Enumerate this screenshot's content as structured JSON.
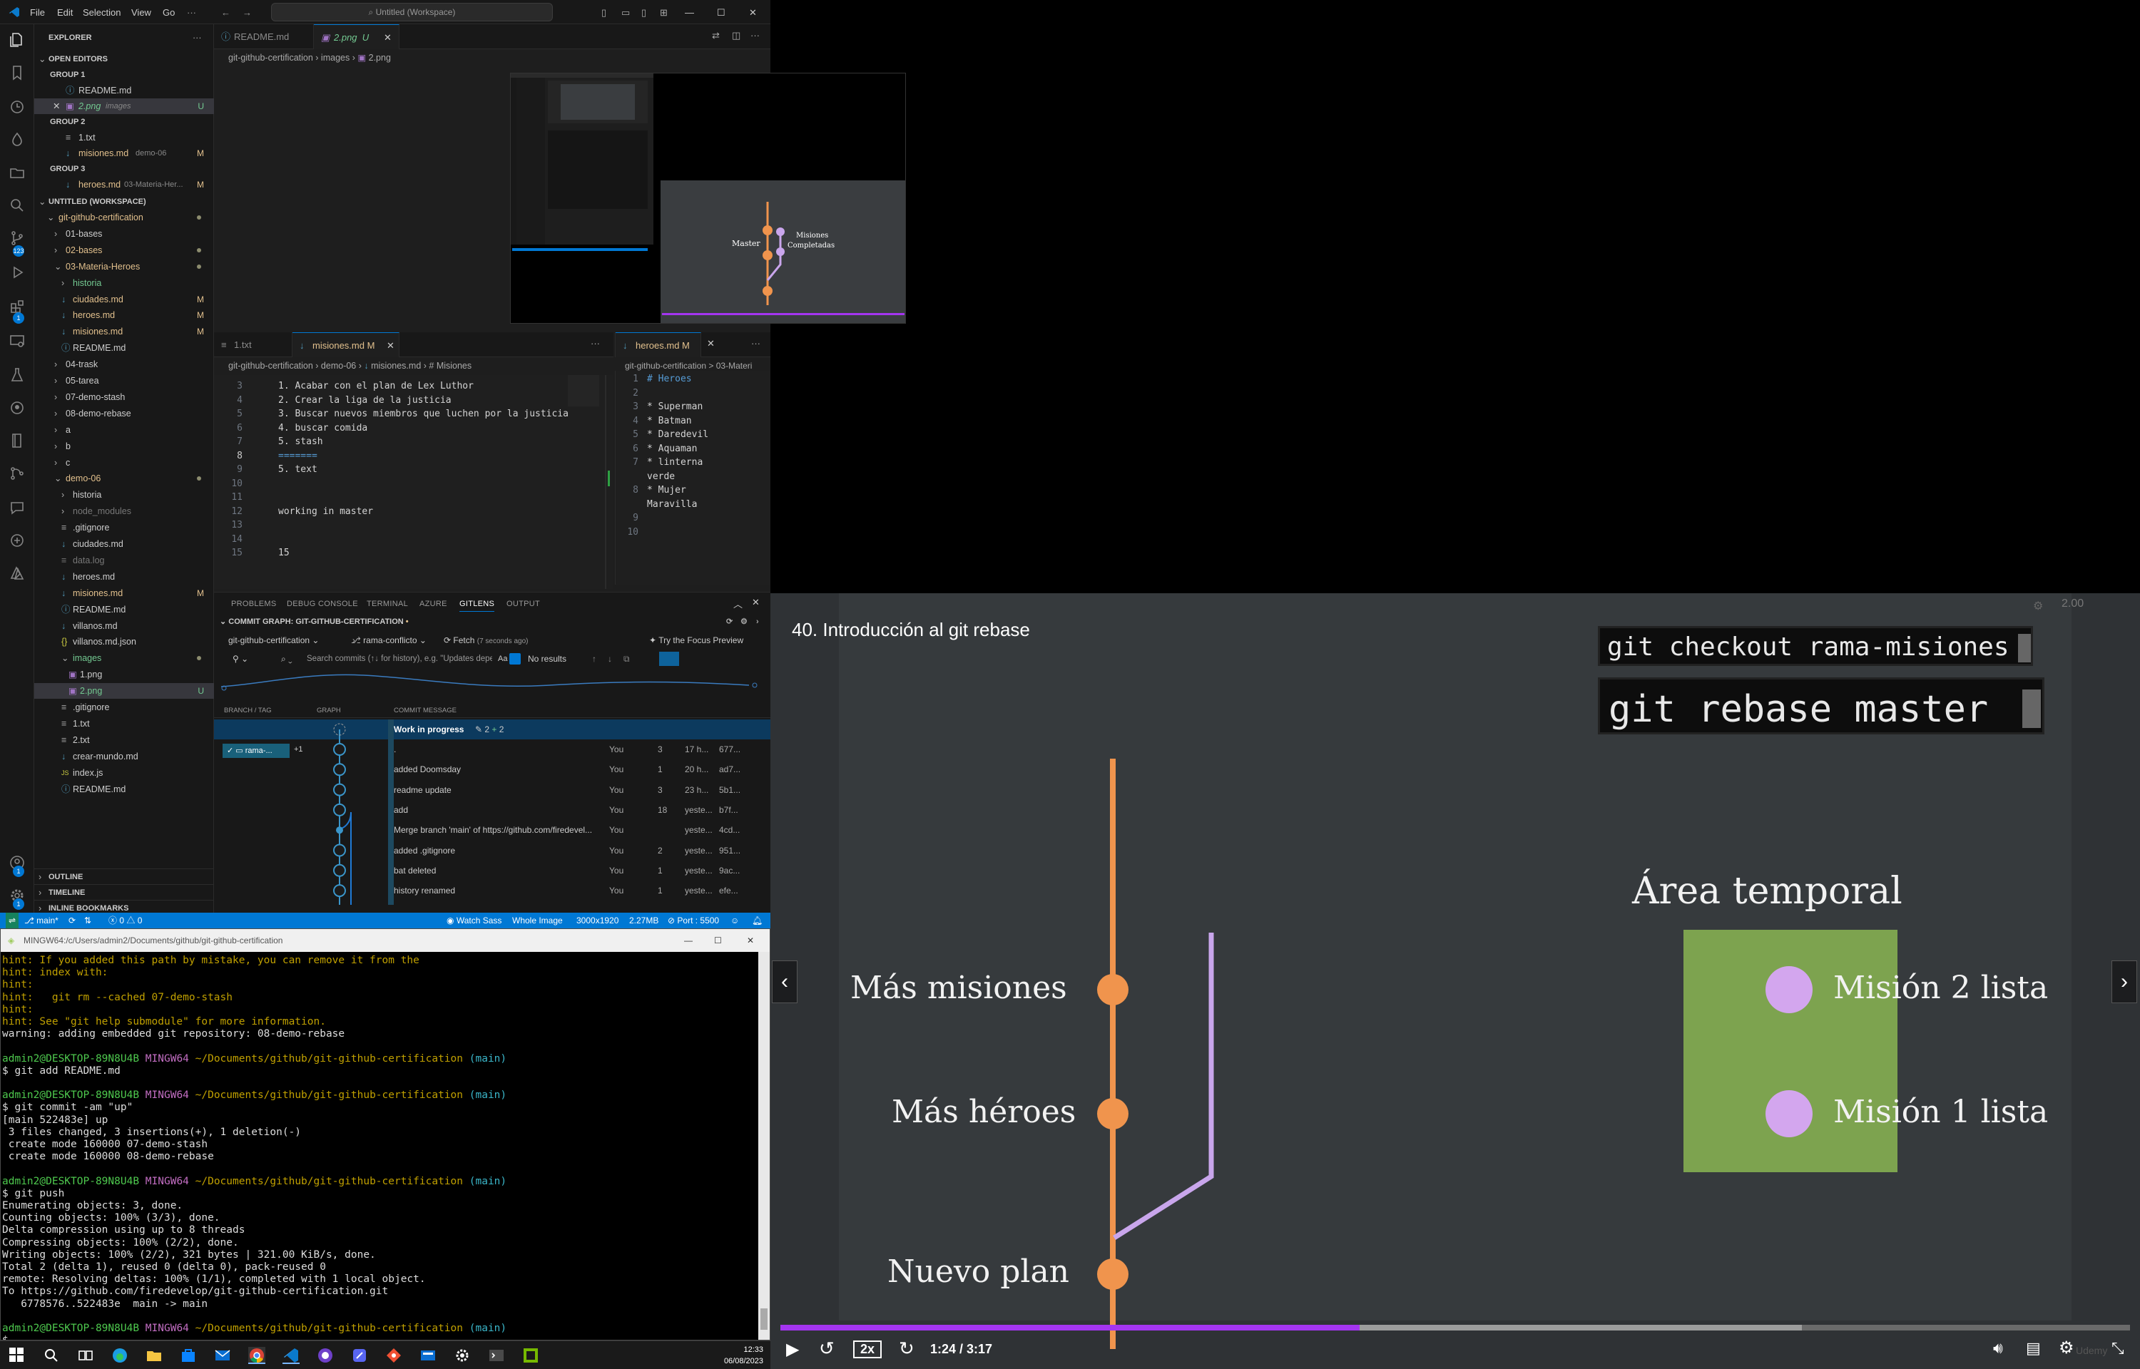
{
  "vscode": {
    "title": "Untitled (Workspace)",
    "menu": [
      "File",
      "Edit",
      "Selection",
      "View",
      "Go"
    ],
    "sidebar": {
      "explorer_label": "EXPLORER",
      "open_editors": "OPEN EDITORS",
      "group1": "GROUP 1",
      "group2": "GROUP 2",
      "group3": "GROUP 3",
      "g1_readme": "README.md",
      "g1_png": "2.png",
      "g1_png_dir": "images",
      "g1_png_mark": "U",
      "g2_txt": "1.txt",
      "g2_misiones": "misiones.md",
      "g2_misiones_dir": "demo-06",
      "g2_mark": "M",
      "g3_heroes": "heroes.md",
      "g3_heroes_dir": "03-Materia-Her...",
      "g3_mark": "M",
      "workspace": "UNTITLED (WORKSPACE)",
      "tree": [
        {
          "label": "git-github-certification",
          "mark": "dot",
          "color": "#e2c08d"
        },
        {
          "label": "01-bases",
          "mark": "",
          "color": "#ccc"
        },
        {
          "label": "02-bases",
          "mark": "dot",
          "color": "#e2c08d"
        },
        {
          "label": "03-Materia-Heroes",
          "mark": "dot",
          "color": "#e2c08d"
        },
        {
          "label": "historia",
          "mark": "",
          "color": "#73c991"
        },
        {
          "label": "ciudades.md",
          "mark": "M",
          "color": "#e2c08d"
        },
        {
          "label": "heroes.md",
          "mark": "M",
          "color": "#e2c08d"
        },
        {
          "label": "misiones.md",
          "mark": "M",
          "color": "#e2c08d"
        },
        {
          "label": "README.md",
          "mark": "",
          "color": "#ccc"
        },
        {
          "label": "04-trask",
          "mark": "",
          "color": "#ccc"
        },
        {
          "label": "05-tarea",
          "mark": "",
          "color": "#ccc"
        },
        {
          "label": "07-demo-stash",
          "mark": "",
          "color": "#ccc"
        },
        {
          "label": "08-demo-rebase",
          "mark": "",
          "color": "#ccc"
        },
        {
          "label": "a",
          "mark": "",
          "color": "#ccc"
        },
        {
          "label": "b",
          "mark": "",
          "color": "#ccc"
        },
        {
          "label": "c",
          "mark": "",
          "color": "#ccc"
        },
        {
          "label": "demo-06",
          "mark": "dot",
          "color": "#e2c08d"
        },
        {
          "label": "historia",
          "mark": "",
          "color": "#ccc"
        },
        {
          "label": "node_modules",
          "mark": "",
          "color": "#777"
        },
        {
          "label": ".gitignore",
          "mark": "",
          "color": "#ccc"
        },
        {
          "label": "ciudades.md",
          "mark": "",
          "color": "#ccc"
        },
        {
          "label": "data.log",
          "mark": "",
          "color": "#777"
        },
        {
          "label": "heroes.md",
          "mark": "",
          "color": "#ccc"
        },
        {
          "label": "misiones.md",
          "mark": "M",
          "color": "#e2c08d"
        },
        {
          "label": "README.md",
          "mark": "",
          "color": "#ccc"
        },
        {
          "label": "villanos.md",
          "mark": "",
          "color": "#ccc"
        },
        {
          "label": "villanos.md.json",
          "mark": "",
          "color": "#ccc"
        },
        {
          "label": "images",
          "mark": "dot",
          "color": "#73c991"
        },
        {
          "label": "1.png",
          "mark": "",
          "color": "#ccc"
        },
        {
          "label": "2.png",
          "mark": "U",
          "color": "#73c991"
        },
        {
          "label": ".gitignore",
          "mark": "",
          "color": "#ccc"
        },
        {
          "label": "1.txt",
          "mark": "",
          "color": "#ccc"
        },
        {
          "label": "2.txt",
          "mark": "",
          "color": "#ccc"
        },
        {
          "label": "crear-mundo.md",
          "mark": "",
          "color": "#ccc"
        },
        {
          "label": "index.js",
          "mark": "",
          "color": "#ccc"
        },
        {
          "label": "README.md",
          "mark": "",
          "color": "#ccc"
        }
      ],
      "outline": "OUTLINE",
      "timeline": "TIMELINE",
      "bookmarks": "INLINE BOOKMARKS"
    },
    "top_tabs": [
      {
        "label": "README.md",
        "active": false
      },
      {
        "label": "2.png",
        "suffix": "U",
        "active": true
      }
    ],
    "crumb_top": [
      "git-github-certification",
      "images",
      "2.png"
    ],
    "thumb_labels": {
      "master": "Master",
      "misiones": "Misiones",
      "completadas": "Completadas"
    },
    "left_editor": {
      "tabs": [
        {
          "label": "1.txt"
        },
        {
          "label": "misiones.md",
          "suffix": "M"
        }
      ],
      "crumb": [
        "git-github-certification",
        "demo-06",
        "misiones.md",
        "# Misiones"
      ],
      "lines": [
        {
          "n": "3",
          "t": "1. Acabar con el plan de Lex Luthor"
        },
        {
          "n": "4",
          "t": "2. Crear la liga de la justicia"
        },
        {
          "n": "5",
          "t": "3. Buscar nuevos miembros que luchen por la justicia"
        },
        {
          "n": "6",
          "t": "4. buscar comida"
        },
        {
          "n": "7",
          "t": "5. stash"
        },
        {
          "n": "8",
          "t": "======="
        },
        {
          "n": "9",
          "t": "5. text"
        },
        {
          "n": "10",
          "t": ""
        },
        {
          "n": "11",
          "t": ""
        },
        {
          "n": "12",
          "t": "working in master"
        },
        {
          "n": "13",
          "t": ""
        },
        {
          "n": "14",
          "t": ""
        },
        {
          "n": "15",
          "t": "15"
        }
      ]
    },
    "right_editor": {
      "tab": "heroes.md",
      "tab_suffix": "M",
      "crumb": "git-github-certification > 03-Materi",
      "lines": [
        {
          "n": "1",
          "t": "# Heroes"
        },
        {
          "n": "2",
          "t": ""
        },
        {
          "n": "3",
          "t": "* Superman"
        },
        {
          "n": "4",
          "t": "* Batman"
        },
        {
          "n": "5",
          "t": "* Daredevil"
        },
        {
          "n": "6",
          "t": "* Aquaman"
        },
        {
          "n": "7",
          "t": "* linterna"
        },
        {
          "n": "",
          "t": "verde"
        },
        {
          "n": "8",
          "t": "* Mujer"
        },
        {
          "n": "",
          "t": "Maravilla"
        },
        {
          "n": "9",
          "t": ""
        },
        {
          "n": "10",
          "t": ""
        }
      ]
    },
    "panel": {
      "tabs": [
        "PROBLEMS",
        "DEBUG CONSOLE",
        "TERMINAL",
        "AZURE",
        "GITLENS",
        "OUTPUT"
      ],
      "active_tab": "GITLENS",
      "graph_title": "COMMIT GRAPH: GIT-GITHUB-CERTIFICATION",
      "repo": "git-github-certification",
      "branch": "rama-conflicto",
      "fetch": "Fetch",
      "fetch_time": "(7 seconds ago)",
      "focus": "Try the Focus Preview",
      "search_placeholder": "Search commits (↑↓ for history), e.g. \"Updates dependencies\" a...",
      "search_aa": "Aa",
      "no_results": "No results",
      "col_branch": "BRANCH / TAG",
      "col_graph": "GRAPH",
      "col_msg": "COMMIT MESSAGE",
      "branch_pill": "rama-...",
      "branch_plus": "+1",
      "wip": "Work in progress",
      "wip_changes": "2",
      "wip_adds": "2",
      "commits": [
        {
          "msg": ".",
          "author": "You",
          "files": "3",
          "time": "17 h...",
          "sha": "677..."
        },
        {
          "msg": "added Doomsday",
          "author": "You",
          "files": "1",
          "time": "20 h...",
          "sha": "ad7..."
        },
        {
          "msg": "readme update",
          "author": "You",
          "files": "3",
          "time": "23 h...",
          "sha": "5b1..."
        },
        {
          "msg": "add",
          "author": "You",
          "files": "18",
          "time": "yeste...",
          "sha": "b7f..."
        },
        {
          "msg": "Merge branch 'main' of https://github.com/firedevel...",
          "author": "You",
          "files": "",
          "time": "yeste...",
          "sha": "4cd..."
        },
        {
          "msg": "added .gitignore",
          "author": "You",
          "files": "2",
          "time": "yeste...",
          "sha": "951..."
        },
        {
          "msg": "bat deleted",
          "author": "You",
          "files": "1",
          "time": "yeste...",
          "sha": "9ac..."
        },
        {
          "msg": "history renamed",
          "author": "You",
          "files": "1",
          "time": "yeste...",
          "sha": "efe..."
        }
      ]
    },
    "status": {
      "branch": "main*",
      "errors": "0",
      "warnings": "0",
      "watch": "Watch Sass",
      "image": "Whole Image",
      "dims": "3000x1920",
      "size": "2.27MB",
      "port": "Port : 5500"
    }
  },
  "terminal": {
    "title": "MINGW64:/c/Users/admin2/Documents/github/git-github-certification",
    "lines": [
      {
        "c": "hint",
        "t": "hint: If you added this path by mistake, you can remove it from the"
      },
      {
        "c": "hint",
        "t": "hint: index with:"
      },
      {
        "c": "hint",
        "t": "hint:"
      },
      {
        "c": "hint",
        "t": "hint:   git rm --cached 07-demo-stash"
      },
      {
        "c": "hint",
        "t": "hint:"
      },
      {
        "c": "hint",
        "t": "hint: See \"git help submodule\" for more information."
      },
      {
        "c": "",
        "t": "warning: adding embedded git repository: 08-demo-rebase"
      },
      {
        "c": "",
        "t": ""
      },
      {
        "c": "prompt",
        "t": ""
      },
      {
        "c": "",
        "t": "$ git add README.md"
      },
      {
        "c": "",
        "t": ""
      },
      {
        "c": "prompt",
        "t": ""
      },
      {
        "c": "",
        "t": "$ git commit -am \"up\""
      },
      {
        "c": "",
        "t": "[main 522483e] up"
      },
      {
        "c": "",
        "t": " 3 files changed, 3 insertions(+), 1 deletion(-)"
      },
      {
        "c": "",
        "t": " create mode 160000 07-demo-stash"
      },
      {
        "c": "",
        "t": " create mode 160000 08-demo-rebase"
      },
      {
        "c": "",
        "t": ""
      },
      {
        "c": "prompt",
        "t": ""
      },
      {
        "c": "",
        "t": "$ git push"
      },
      {
        "c": "",
        "t": "Enumerating objects: 3, done."
      },
      {
        "c": "",
        "t": "Counting objects: 100% (3/3), done."
      },
      {
        "c": "",
        "t": "Delta compression using up to 8 threads"
      },
      {
        "c": "",
        "t": "Compressing objects: 100% (2/2), done."
      },
      {
        "c": "",
        "t": "Writing objects: 100% (2/2), 321 bytes | 321.00 KiB/s, done."
      },
      {
        "c": "",
        "t": "Total 2 (delta 1), reused 0 (delta 0), pack-reused 0"
      },
      {
        "c": "",
        "t": "remote: Resolving deltas: 100% (1/1), completed with 1 local object."
      },
      {
        "c": "",
        "t": "To https://github.com/firedevelop/git-github-certification.git"
      },
      {
        "c": "",
        "t": "   6778576..522483e  main -> main"
      },
      {
        "c": "",
        "t": ""
      },
      {
        "c": "prompt",
        "t": ""
      },
      {
        "c": "",
        "t": "$ "
      }
    ],
    "prompt_user": "admin2@DESKTOP-89N8U4B",
    "prompt_env": "MINGW64",
    "prompt_path": "~/Documents/github/git-github-certification",
    "prompt_branch": "(main)"
  },
  "taskbar": {
    "time": "12:33",
    "date": "06/08/2023"
  },
  "player": {
    "title": "40. Introducción al git rebase",
    "cmd1": "git checkout rama-misiones",
    "cmd2": "git rebase master",
    "area": "Área temporal",
    "mision2": "Misión 2 lista",
    "mision1": "Misión 1 lista",
    "mas_misiones": "Más misiones",
    "mas_heroes": "Más héroes",
    "nuevo_plan": "Nuevo plan",
    "speed": "2x",
    "time": "1:24 / 3:17",
    "progress_fraction": 0.429,
    "buffer_fraction": 0.757,
    "speed_badge": "2.00",
    "brand": "Udemy",
    "accent": "#a435f0",
    "branch_color": "#f0944d",
    "feature_color": "#c9a6ec"
  }
}
